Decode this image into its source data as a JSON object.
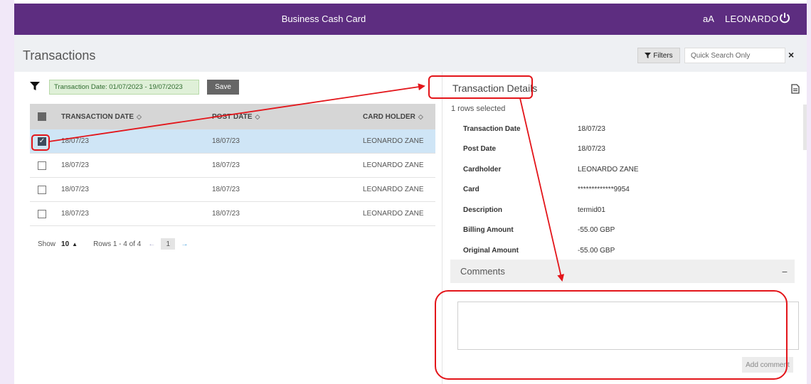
{
  "header": {
    "app_title": "Business Cash Card",
    "text_size_label": "aA",
    "user_name": "LEONARDO"
  },
  "toolbar": {
    "page_title": "Transactions",
    "filters_label": "Filters",
    "quick_search_placeholder": "Quick Search Only",
    "clear_label": "×"
  },
  "filter": {
    "chip_label": "Transaction Date: 01/07/2023 - 19/07/2023",
    "save_label": "Save"
  },
  "grid": {
    "columns": [
      "TRANSACTION DATE",
      "POST DATE",
      "CARD HOLDER"
    ],
    "rows": [
      {
        "transaction_date": "18/07/23",
        "post_date": "18/07/23",
        "card_holder": "LEONARDO ZANE",
        "selected": true
      },
      {
        "transaction_date": "18/07/23",
        "post_date": "18/07/23",
        "card_holder": "LEONARDO ZANE",
        "selected": false
      },
      {
        "transaction_date": "18/07/23",
        "post_date": "18/07/23",
        "card_holder": "LEONARDO ZANE",
        "selected": false
      },
      {
        "transaction_date": "18/07/23",
        "post_date": "18/07/23",
        "card_holder": "LEONARDO ZANE",
        "selected": false
      }
    ]
  },
  "pager": {
    "show_label": "Show",
    "page_size": "10",
    "range_label": "Rows 1 - 4 of 4",
    "current_page": "1"
  },
  "details": {
    "title": "Transaction Details",
    "rows_selected": "1 rows selected",
    "fields": [
      {
        "label": "Transaction Date",
        "value": "18/07/23"
      },
      {
        "label": "Post Date",
        "value": "18/07/23"
      },
      {
        "label": "Cardholder",
        "value": "LEONARDO ZANE"
      },
      {
        "label": "Card",
        "value": "*************9954"
      },
      {
        "label": "Description",
        "value": "termid01"
      },
      {
        "label": "Billing Amount",
        "value": "-55.00 GBP"
      },
      {
        "label": "Original Amount",
        "value": "-55.00 GBP"
      }
    ]
  },
  "comments": {
    "title": "Comments",
    "collapse_label": "−",
    "add_label": "Add comment"
  },
  "colors": {
    "brand": "#5d2d80",
    "selected_row": "#cfe5f6",
    "annotation": "#e3151a"
  }
}
